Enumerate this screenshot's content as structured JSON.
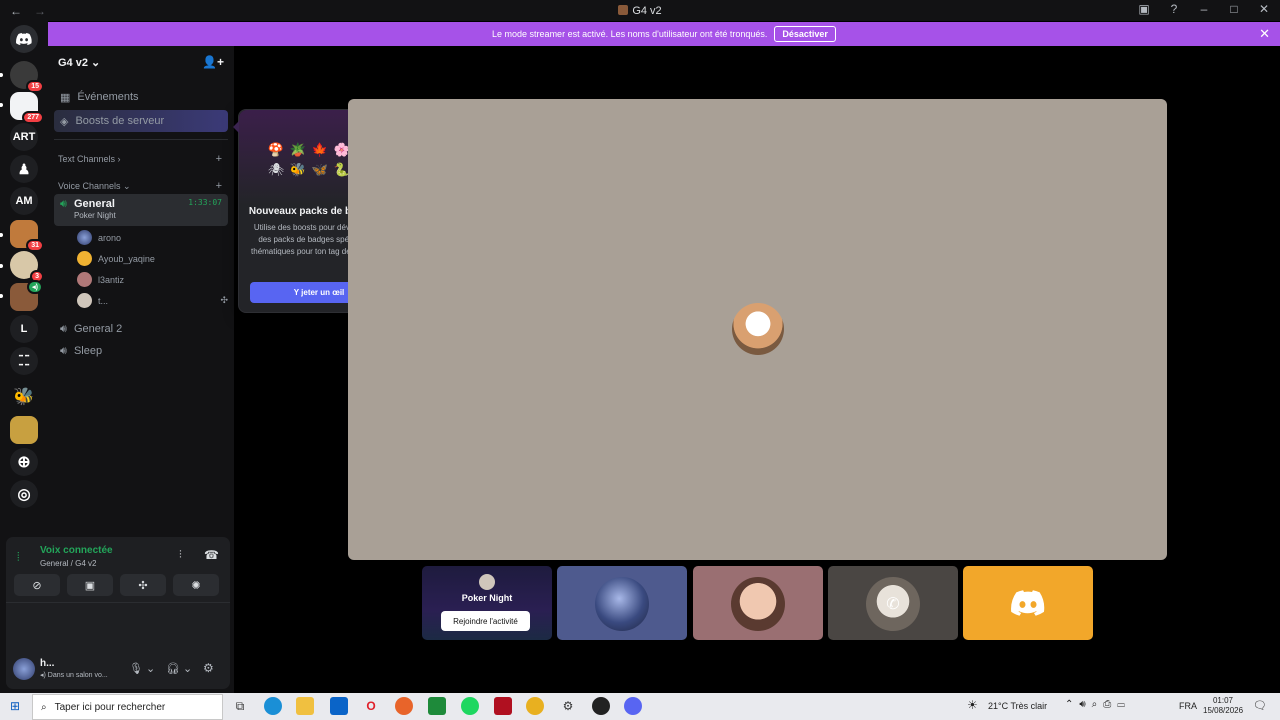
{
  "window": {
    "title": "G4 v2"
  },
  "banner": {
    "message": "Le mode streamer est activé. Les noms d'utilisateur ont été tronqués.",
    "button_label": "Désactiver"
  },
  "rail": {
    "badges": [
      "15",
      "277",
      "31",
      "3"
    ],
    "servers_text": [
      "ART",
      "AM",
      "L"
    ]
  },
  "server": {
    "name": "G4 v2"
  },
  "sidebar": {
    "events_label": "Événements",
    "boosts_label": "Boosts de serveur",
    "text_category": "Text Channels",
    "voice_category": "Voice Channels",
    "channels": [
      {
        "name": "General",
        "subtitle": "Poker Night",
        "timer": "1:33:07"
      },
      {
        "name": "General 2"
      },
      {
        "name": "Sleep"
      }
    ],
    "voice_users": [
      "arono",
      "Ayoub_yaqine",
      "l3antiz",
      "t..."
    ]
  },
  "voice_panel": {
    "status": "Voix connectée",
    "location": "General / G4 v2",
    "username": "h...",
    "user_status": "Dans un salon vo..."
  },
  "popup": {
    "title": "Nouveaux packs de badges !",
    "body": "Utilise des boosts pour déverrouiller des packs de badges spéciaux et thématiques pour ton tag de serveur !",
    "cta": "Y jeter un œil",
    "badges": [
      "🍄",
      "🪴",
      "🍁",
      "🌸",
      "🍀",
      "🕷",
      "🐝",
      "🦋",
      "🐍",
      "🐌"
    ]
  },
  "tiles": {
    "activity_name": "Poker Night",
    "join_label": "Rejoindre l'activité"
  },
  "taskbar": {
    "search_placeholder": "Taper ici pour rechercher",
    "weather": "21°C  Très clair",
    "language": "FRA",
    "time": "01:07",
    "date": "15/08/2026"
  },
  "colors": {
    "accent": "#5865f2",
    "banner": "#a652e8",
    "voice_green": "#23a55a",
    "stage_bg": "#a9a096",
    "discord_tile": "#f2a72a"
  }
}
